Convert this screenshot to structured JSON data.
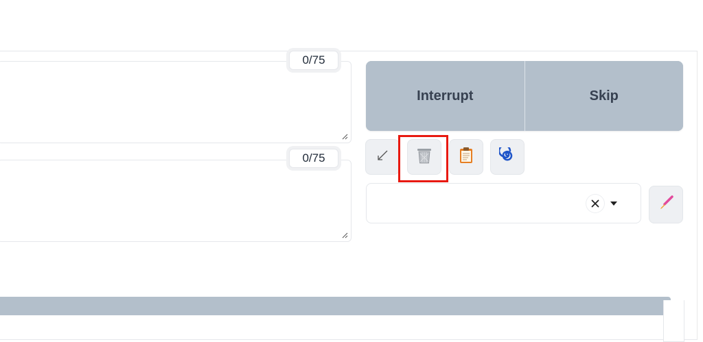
{
  "prompt": {
    "value": "",
    "token_count": "0/75"
  },
  "negative_prompt": {
    "value": "",
    "token_count": "0/75"
  },
  "actions": {
    "interrupt_label": "Interrupt",
    "skip_label": "Skip"
  },
  "tools": [
    {
      "name": "read-generation-params",
      "icon": "arrow-down-left-icon"
    },
    {
      "name": "clear-prompt",
      "icon": "trash-icon"
    },
    {
      "name": "apply-styles",
      "icon": "clipboard-icon"
    },
    {
      "name": "extra-networks",
      "icon": "spiral-icon"
    }
  ],
  "styles": {
    "selected": "",
    "edit_icon": "paintbrush-icon"
  },
  "progress": {
    "value": 1.0
  },
  "colors": {
    "accent_button": "#b3bfcb",
    "highlight": "#e8190f",
    "spiral": "#1f55c9",
    "clipboard": "#e67e22",
    "brush_tip": "#e24a9c"
  }
}
